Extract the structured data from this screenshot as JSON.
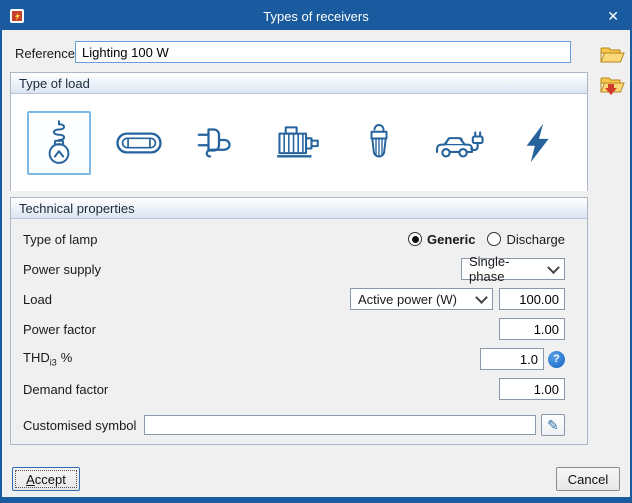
{
  "window": {
    "title": "Types of receivers",
    "close_glyph": "✕"
  },
  "reference": {
    "label": "Reference",
    "value": "Lighting 100 W"
  },
  "type_of_load": {
    "title": "Type of load",
    "selected_index": 0,
    "items": [
      {
        "icon": "incandescent-lamp-icon",
        "selected": true
      },
      {
        "icon": "fluorescent-luminaire-icon",
        "selected": false
      },
      {
        "icon": "plug-icon",
        "selected": false
      },
      {
        "icon": "motor-icon",
        "selected": false
      },
      {
        "icon": "hoist-icon",
        "selected": false
      },
      {
        "icon": "electric-vehicle-icon",
        "selected": false
      },
      {
        "icon": "lightning-bolt-icon",
        "selected": false
      }
    ]
  },
  "technical": {
    "title": "Technical properties",
    "type_of_lamp": {
      "label": "Type of lamp",
      "options": [
        {
          "label": "Generic",
          "selected": true
        },
        {
          "label": "Discharge",
          "selected": false
        }
      ]
    },
    "power_supply": {
      "label": "Power supply",
      "value": "Single-phase"
    },
    "load": {
      "label": "Load",
      "mode": "Active power (W)",
      "value": "100.00"
    },
    "power_factor": {
      "label": "Power factor",
      "value": "1.00"
    },
    "thd": {
      "label_base": "THD",
      "label_sub": "i3",
      "label_percent": "%",
      "value": "1.0",
      "help_glyph": "?"
    },
    "demand_factor": {
      "label": "Demand factor",
      "value": "1.00"
    },
    "customised_symbol": {
      "label": "Customised symbol",
      "value": ""
    }
  },
  "footer": {
    "accept_mnemonic": "A",
    "accept_rest": "ccept",
    "cancel_label": "Cancel"
  },
  "icons": {
    "pencil": "✎",
    "side_buttons": [
      "folder-open-icon",
      "folder-import-icon"
    ]
  },
  "colors": {
    "titlebar_blue": "#1a5a9e",
    "icon_blue": "#26639c",
    "selection_border": "#7cb9e5",
    "folder_yellow": "#f7c74e",
    "help_blue": "#1565c0"
  }
}
